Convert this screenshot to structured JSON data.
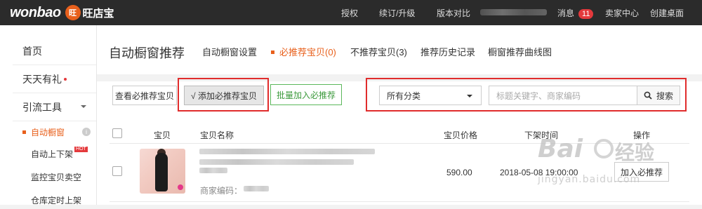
{
  "brand": {
    "logo_text": "wonbao",
    "logo_badge": "旺",
    "logo_cn": "旺店宝"
  },
  "topnav": {
    "authorize": "授权",
    "renew": "续订/升级",
    "compare": "版本对比",
    "messages": "消息",
    "message_count": "11",
    "seller_center": "卖家中心",
    "desktop": "创建桌面"
  },
  "sidebar": {
    "home": "首页",
    "daily_gift": "天天有礼",
    "traffic_tools": "引流工具",
    "sub": {
      "auto_window": "自动橱窗",
      "auto_shelf": "自动上下架",
      "hot_badge": "HOT",
      "monitor": "监控宝贝卖空",
      "warehouse": "仓库定时上架"
    }
  },
  "page": {
    "title": "自动橱窗推荐"
  },
  "tabs": [
    {
      "label": "自动橱窗设置"
    },
    {
      "label": "必推荐宝贝(0)"
    },
    {
      "label": "不推荐宝贝(3)"
    },
    {
      "label": "推荐历史记录"
    },
    {
      "label": "橱窗推荐曲线图"
    }
  ],
  "toolbar": {
    "view_must": "查看必推荐宝贝",
    "add_must": "√ 添加必推荐宝贝",
    "batch_add": "批量加入必推荐",
    "category": "所有分类",
    "search_placeholder": "标题关键字、商家编码",
    "search_btn": "搜索"
  },
  "table": {
    "headers": {
      "item": "宝贝",
      "name": "宝贝名称",
      "price": "宝贝价格",
      "offtime": "下架时间",
      "action": "操作"
    },
    "rows": [
      {
        "merchant_code_label": "商家编码：",
        "price": "590.00",
        "offtime": "2018-05-08 19:00:00",
        "action": "加入必推荐"
      }
    ]
  },
  "watermark": {
    "brand": "Bai",
    "cn": "经验",
    "url": "jingyan.baidu.com"
  },
  "colors": {
    "accent": "#e8601c",
    "highlight": "#e02c2c",
    "topbar": "#2b2b2b"
  }
}
